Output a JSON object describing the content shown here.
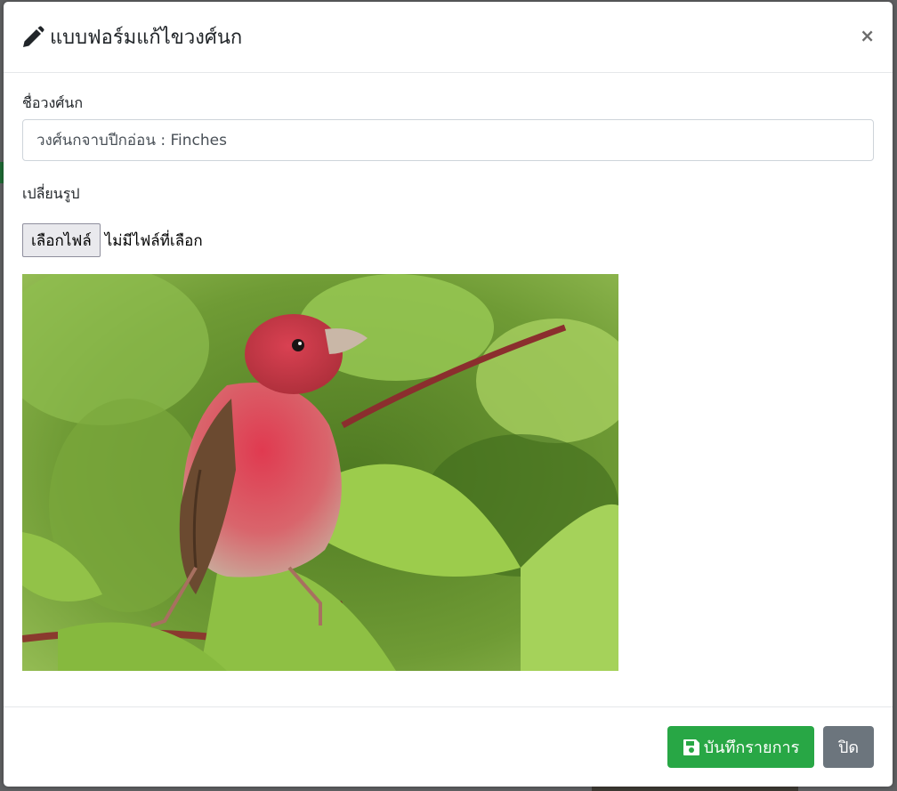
{
  "modal": {
    "title": "แบบฟอร์มแก้ไขวงศ์นก",
    "close_symbol": "×"
  },
  "form": {
    "name_label": "ชื่อวงศ์นก",
    "name_value": "วงศ์นกจาบปีกอ่อน : Finches",
    "image_label": "เปลี่ยนรูป",
    "file_button_label": "เลือกไฟล์",
    "file_status": "ไม่มีไฟล์ที่เลือก"
  },
  "footer": {
    "save_label": "บันทึกรายการ",
    "close_label": "ปิด"
  },
  "icons": {
    "title_icon": "pencil-icon",
    "save_icon": "floppy-disk-icon"
  },
  "colors": {
    "save_button": "#28a745",
    "close_button": "#6c757d"
  }
}
